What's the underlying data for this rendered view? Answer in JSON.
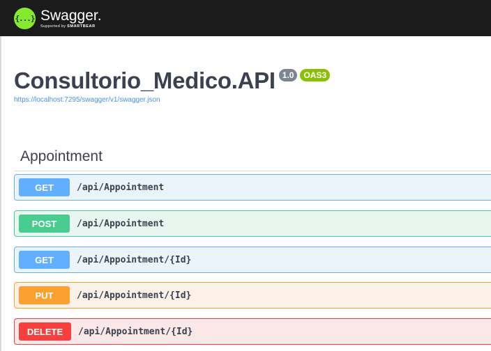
{
  "topbar": {
    "logo_glyph": "{...}",
    "logo_name": "Swagger.",
    "logo_sub_prefix": "Supported by ",
    "logo_sub_brand": "SMARTBEAR",
    "accent": "#85ea2d",
    "background": "#1b1b1b"
  },
  "info": {
    "title": "Consultorio_Medico.API",
    "version": "1.0",
    "oas_badge": "OAS3",
    "spec_url": "https://localhost:7295/swagger/v1/swagger.json"
  },
  "tag": {
    "name": "Appointment"
  },
  "operations": [
    {
      "method": "GET",
      "path": "/api/Appointment",
      "color": "#61affe"
    },
    {
      "method": "POST",
      "path": "/api/Appointment",
      "color": "#49cc90"
    },
    {
      "method": "GET",
      "path": "/api/Appointment/{Id}",
      "color": "#61affe"
    },
    {
      "method": "PUT",
      "path": "/api/Appointment/{Id}",
      "color": "#fca130"
    },
    {
      "method": "DELETE",
      "path": "/api/Appointment/{Id}",
      "color": "#f93e3e"
    }
  ]
}
